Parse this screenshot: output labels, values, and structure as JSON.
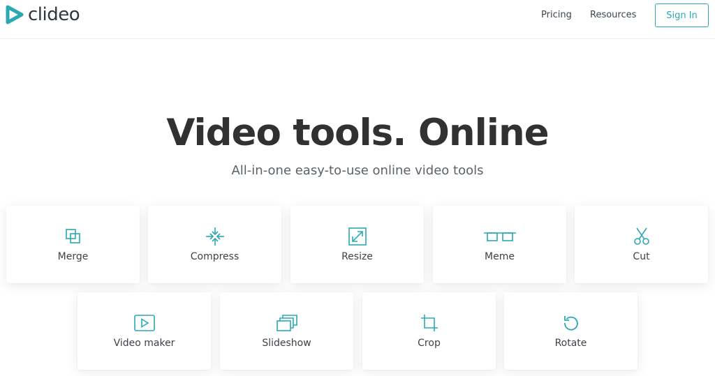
{
  "brand": {
    "name": "clideo",
    "accent": "#2aa9b4"
  },
  "header": {
    "nav": {
      "pricing": "Pricing",
      "resources": "Resources"
    },
    "signin_label": "Sign In"
  },
  "hero": {
    "title": "Video tools. Online",
    "subtitle": "All-in-one easy-to-use online video tools"
  },
  "tools": [
    {
      "label": "Merge",
      "icon": "merge-icon"
    },
    {
      "label": "Compress",
      "icon": "compress-icon"
    },
    {
      "label": "Resize",
      "icon": "resize-icon"
    },
    {
      "label": "Meme",
      "icon": "meme-icon"
    },
    {
      "label": "Cut",
      "icon": "scissors-icon"
    },
    {
      "label": "Video maker",
      "icon": "play-icon"
    },
    {
      "label": "Slideshow",
      "icon": "slides-icon"
    },
    {
      "label": "Crop",
      "icon": "crop-icon"
    },
    {
      "label": "Rotate",
      "icon": "rotate-icon"
    }
  ]
}
